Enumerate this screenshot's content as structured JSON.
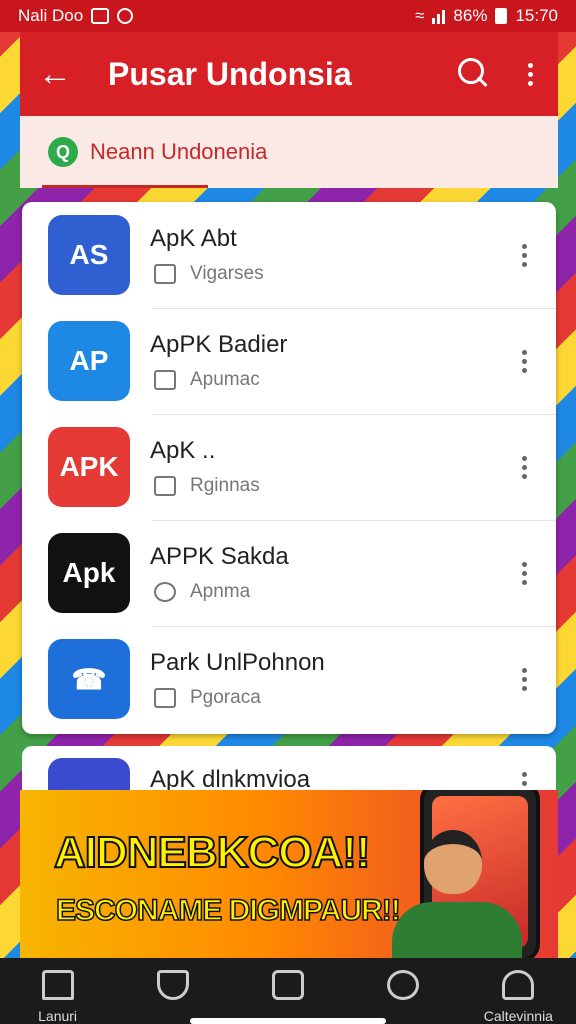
{
  "status_bar": {
    "carrier": "Nali Doo",
    "battery": "86%",
    "time": "15:70"
  },
  "app_bar": {
    "title": "Pusar Undonsia",
    "back_icon": "arrow-left-icon",
    "search_icon": "search-icon",
    "menu_icon": "more-vert-icon"
  },
  "tab": {
    "label": "Neann Undonenia",
    "icon_letter": "Q"
  },
  "apps": [
    {
      "name": "ApK Abt",
      "subtitle": "Vigarses",
      "icon_text": "AS",
      "icon_color": "#2f5fd0"
    },
    {
      "name": "ApPK Badier",
      "subtitle": "Apumac",
      "icon_text": "AP",
      "icon_color": "#1e88e5"
    },
    {
      "name": "ApK ..",
      "subtitle": "Rginnas",
      "icon_text": "APK",
      "icon_color": "#e53935"
    },
    {
      "name": "APPK Sakda",
      "subtitle": "Apnma",
      "icon_text": "Apk",
      "icon_color": "#111111"
    },
    {
      "name": "Park UnlPohnon",
      "subtitle": "Pgoraca",
      "icon_text": "☎",
      "icon_color": "#1e6fd9"
    },
    {
      "name": "ApK dlnkmvioa",
      "subtitle": "",
      "icon_text": "",
      "icon_color": "#3a4bd0"
    }
  ],
  "banner": {
    "headline": "AIDNEBKCOA!!",
    "subline": "ESCONAME DIGMPAUR!!"
  },
  "bottom_nav": [
    {
      "label": "Lanuri",
      "icon": "home-icon"
    },
    {
      "label": "",
      "icon": "shield-icon"
    },
    {
      "label": "",
      "icon": "camera-icon"
    },
    {
      "label": "",
      "icon": "chat-icon"
    },
    {
      "label": "Caltevinnia",
      "icon": "profile-icon"
    }
  ],
  "colors": {
    "primary": "#d71f26",
    "statusbar": "#c9161d",
    "tab_bg": "#fbe9e6"
  }
}
